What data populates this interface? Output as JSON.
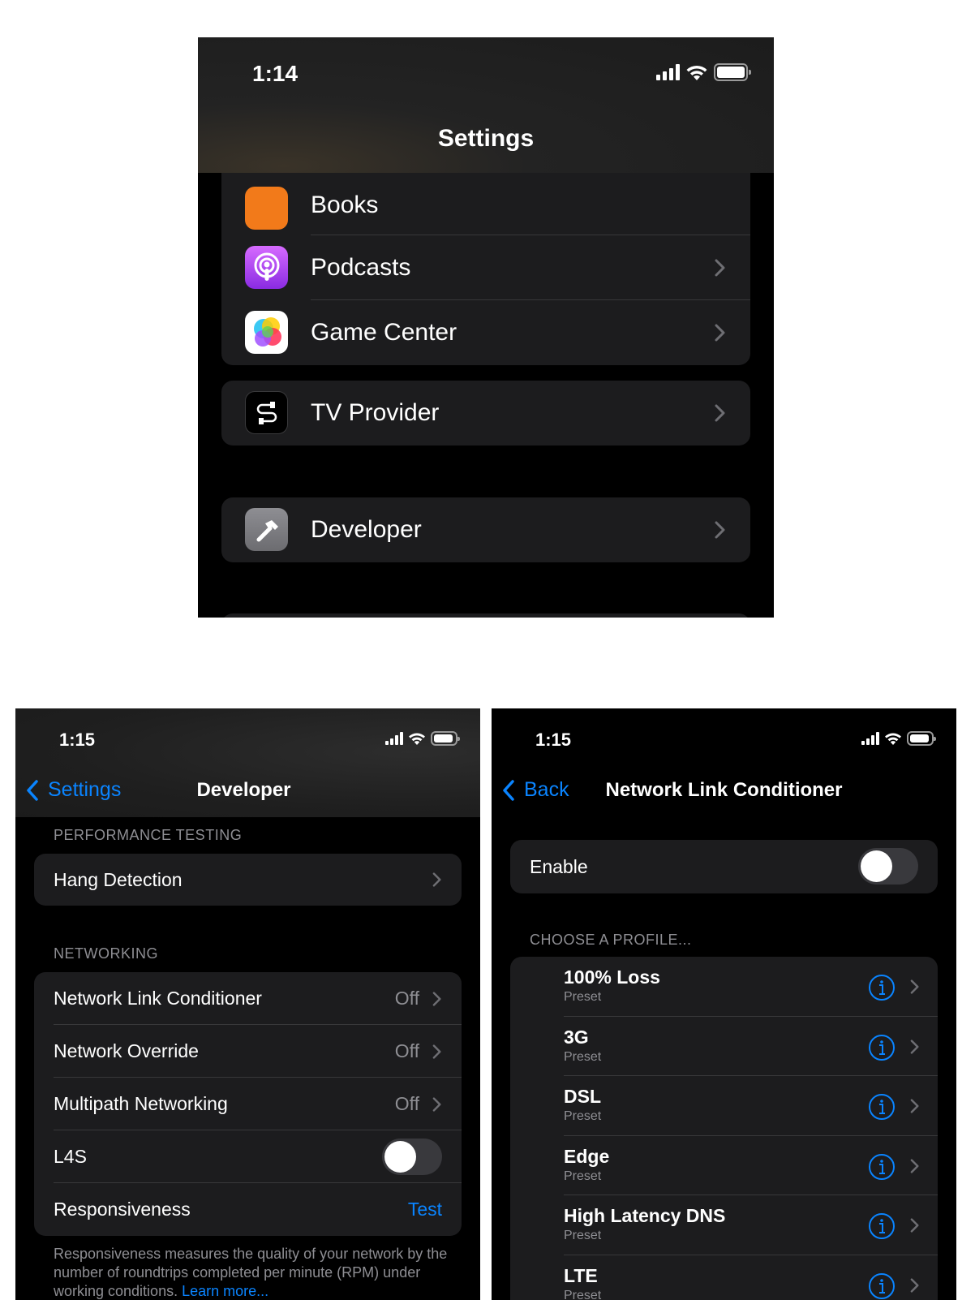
{
  "screen1": {
    "time": "1:14",
    "title": "Settings",
    "partial_item": "Books",
    "group_a": [
      {
        "label": "Podcasts",
        "icon": "podcasts-icon"
      },
      {
        "label": "Game Center",
        "icon": "game-center-icon"
      }
    ],
    "tv_provider": {
      "label": "TV Provider",
      "icon": "tv-provider-icon"
    },
    "developer": {
      "label": "Developer",
      "icon": "hammer-icon"
    }
  },
  "screen2": {
    "time": "1:15",
    "back_label": "Settings",
    "title": "Developer",
    "section_performance": "PERFORMANCE TESTING",
    "hang_detection": "Hang Detection",
    "section_networking": "NETWORKING",
    "networking_rows": [
      {
        "label": "Network Link Conditioner",
        "value": "Off"
      },
      {
        "label": "Network Override",
        "value": "Off"
      },
      {
        "label": "Multipath Networking",
        "value": "Off"
      }
    ],
    "l4s": {
      "label": "L4S",
      "on": false
    },
    "responsiveness": {
      "label": "Responsiveness",
      "action": "Test"
    },
    "footer_text": "Responsiveness measures the quality of your network by the number of roundtrips completed per minute (RPM) under working conditions.",
    "footer_link": "Learn more..."
  },
  "screen3": {
    "time": "1:15",
    "back_label": "Back",
    "title": "Network Link Conditioner",
    "enable": {
      "label": "Enable",
      "on": false
    },
    "section_profile": "CHOOSE A PROFILE...",
    "profiles": [
      {
        "name": "100% Loss",
        "sub": "Preset"
      },
      {
        "name": "3G",
        "sub": "Preset"
      },
      {
        "name": "DSL",
        "sub": "Preset"
      },
      {
        "name": "Edge",
        "sub": "Preset"
      },
      {
        "name": "High Latency DNS",
        "sub": "Preset"
      },
      {
        "name": "LTE",
        "sub": "Preset"
      }
    ]
  },
  "colors": {
    "accent": "#0a84ff",
    "cell_background": "#1c1c1e",
    "secondary_text": "#8e8e93"
  }
}
